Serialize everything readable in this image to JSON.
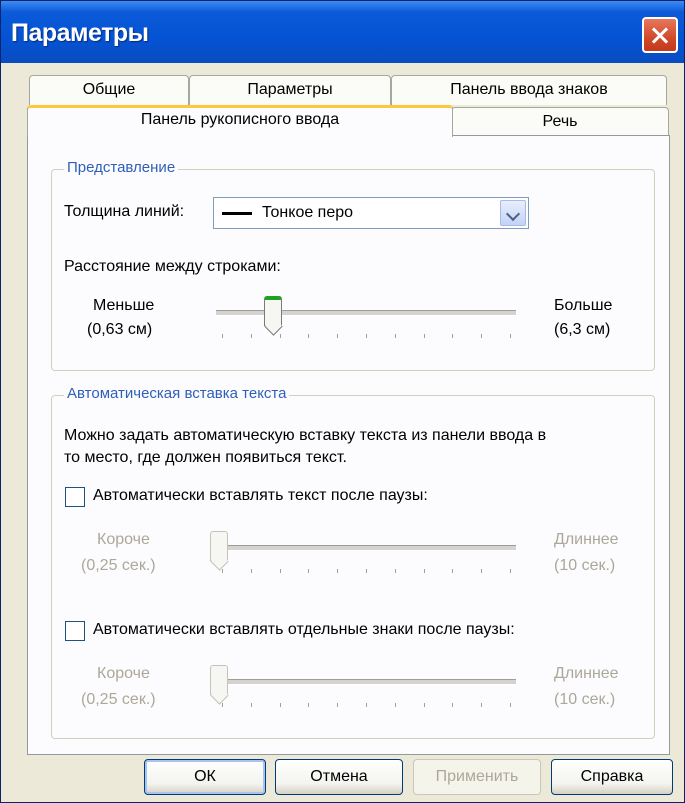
{
  "window": {
    "title": "Параметры"
  },
  "tabs": {
    "row_back": [
      "Общие",
      "Параметры",
      "Панель ввода знаков"
    ],
    "row_front": [
      "Панель рукописного ввода",
      "Речь"
    ]
  },
  "display_group": {
    "title": "Представление",
    "line_width_label": "Толщина линий:",
    "line_width_value": "Тонкое перо",
    "line_spacing_label": "Расстояние между строками:",
    "less_label": "Меньше",
    "less_sub": "(0,63 см)",
    "more_label": "Больше",
    "more_sub": "(6,3 см)",
    "line_spacing_level_fraction": 0.18
  },
  "autoinsert_group": {
    "title": "Автоматическая вставка текста",
    "description_line1": "Можно задать автоматическую вставку текста из панели ввода в",
    "description_line2": "то место, где должен появиться текст.",
    "checkbox_text_label": "Автоматически вставлять текст после паузы:",
    "checkbox_text_checked": false,
    "checkbox_chars_label": "Автоматически вставлять отдельные знаки после паузы:",
    "checkbox_chars_checked": false,
    "shorter_label": "Короче",
    "shorter_sub": "(0,25 сек.)",
    "longer_label": "Длиннее",
    "longer_sub": "(10 сек.)",
    "text_pause_level_fraction": 0.0,
    "chars_pause_level_fraction": 0.0
  },
  "buttons": {
    "ok": "ОК",
    "cancel": "Отмена",
    "apply": "Применить",
    "help": "Справка"
  },
  "colors": {
    "titlebar": "#0453d4",
    "group_title": "#2f5fb8",
    "active_tab_accent": "#ffc83c",
    "disabled_text": "#aca899"
  }
}
